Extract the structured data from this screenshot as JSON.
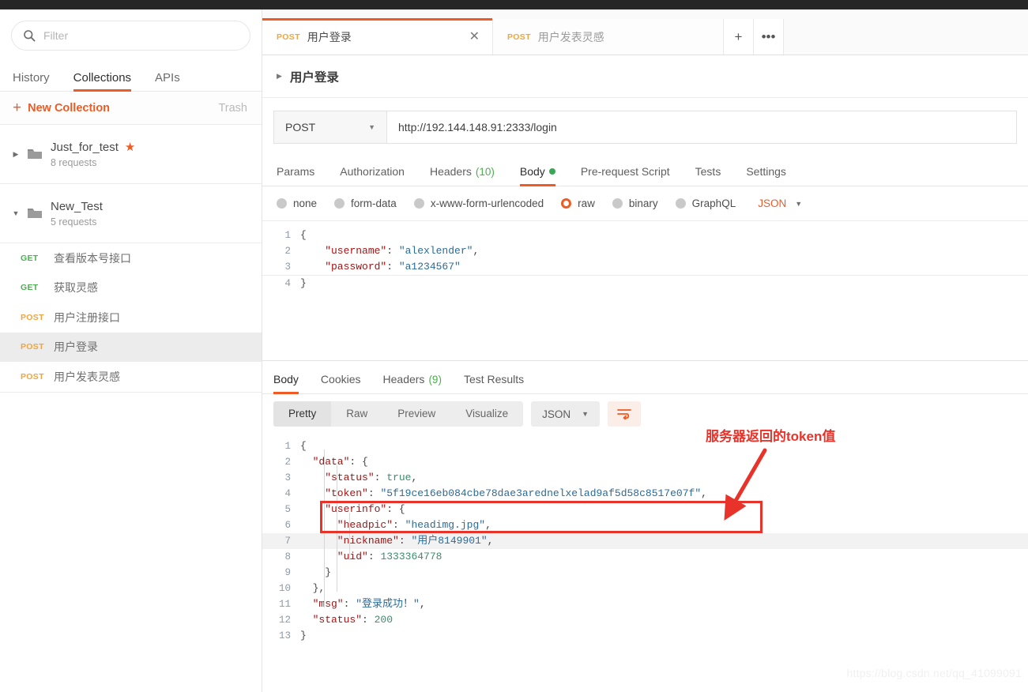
{
  "sidebar": {
    "search": {
      "placeholder": "Filter",
      "value": "",
      "icon": "search-icon"
    },
    "tabs": [
      {
        "label": "History",
        "active": false
      },
      {
        "label": "Collections",
        "active": true
      },
      {
        "label": "APIs",
        "active": false
      }
    ],
    "new_collection_label": "New Collection",
    "trash_label": "Trash",
    "collections": [
      {
        "name": "Just_for_test",
        "sub": "8 requests",
        "expanded": false,
        "starred": true
      },
      {
        "name": "New_Test",
        "sub": "5 requests",
        "expanded": true,
        "starred": false
      }
    ],
    "requests": [
      {
        "method": "GET",
        "name": "查看版本号接口",
        "selected": false
      },
      {
        "method": "GET",
        "name": "获取灵感",
        "selected": false
      },
      {
        "method": "POST",
        "name": "用户注册接口",
        "selected": false
      },
      {
        "method": "POST",
        "name": "用户登录",
        "selected": true
      },
      {
        "method": "POST",
        "name": "用户发表灵感",
        "selected": false
      }
    ]
  },
  "tabstrip": {
    "tabs": [
      {
        "method": "POST",
        "title": "用户登录",
        "active": true,
        "close": "✕"
      },
      {
        "method": "POST",
        "title": "用户发表灵感",
        "active": false,
        "close": ""
      }
    ],
    "new_tab_icon": "+",
    "more_icon": "•••"
  },
  "request": {
    "name": "用户登录",
    "method": "POST",
    "url": "http://192.144.148.91:2333/login",
    "tabs": [
      {
        "label": "Params",
        "active": false,
        "count": "",
        "dot": false
      },
      {
        "label": "Authorization",
        "active": false,
        "count": "",
        "dot": false
      },
      {
        "label": "Headers",
        "active": false,
        "count": "(10)",
        "dot": false
      },
      {
        "label": "Body",
        "active": true,
        "count": "",
        "dot": true
      },
      {
        "label": "Pre-request Script",
        "active": false,
        "count": "",
        "dot": false
      },
      {
        "label": "Tests",
        "active": false,
        "count": "",
        "dot": false
      },
      {
        "label": "Settings",
        "active": false,
        "count": "",
        "dot": false
      }
    ],
    "body_types": [
      {
        "label": "none",
        "selected": false
      },
      {
        "label": "form-data",
        "selected": false
      },
      {
        "label": "x-www-form-urlencoded",
        "selected": false
      },
      {
        "label": "raw",
        "selected": true
      },
      {
        "label": "binary",
        "selected": false
      },
      {
        "label": "GraphQL",
        "selected": false
      }
    ],
    "format": "JSON",
    "body_lines": [
      {
        "n": "1",
        "text": "{"
      },
      {
        "n": "2",
        "text": "    \"username\": \"alexlender\","
      },
      {
        "n": "3",
        "text": "    \"password\": \"a1234567\""
      },
      {
        "n": "4",
        "text": "}"
      }
    ]
  },
  "response": {
    "tabs": [
      {
        "label": "Body",
        "active": true,
        "count": ""
      },
      {
        "label": "Cookies",
        "active": false,
        "count": ""
      },
      {
        "label": "Headers",
        "active": false,
        "count": "(9)"
      },
      {
        "label": "Test Results",
        "active": false,
        "count": ""
      }
    ],
    "views": [
      {
        "label": "Pretty",
        "active": true
      },
      {
        "label": "Raw",
        "active": false
      },
      {
        "label": "Preview",
        "active": false
      },
      {
        "label": "Visualize",
        "active": false
      }
    ],
    "format": "JSON",
    "wrap_icon": "word-wrap-icon",
    "body_lines": [
      {
        "n": "1",
        "text": "{"
      },
      {
        "n": "2",
        "text": "  \"data\": {"
      },
      {
        "n": "3",
        "text": "    \"status\": true,"
      },
      {
        "n": "4",
        "text": "    \"token\": \"5f19ce16eb084cbe78dae3arednelxelad9af5d58c8517e07f\","
      },
      {
        "n": "5",
        "text": "    \"userinfo\": {"
      },
      {
        "n": "6",
        "text": "      \"headpic\": \"headimg.jpg\","
      },
      {
        "n": "7",
        "text": "      \"nickname\": \"用户8149901\","
      },
      {
        "n": "8",
        "text": "      \"uid\": 1333364778"
      },
      {
        "n": "9",
        "text": "    }"
      },
      {
        "n": "10",
        "text": "  },"
      },
      {
        "n": "11",
        "text": "  \"msg\": \"登录成功！\","
      },
      {
        "n": "12",
        "text": "  \"status\": 200"
      },
      {
        "n": "13",
        "text": "}"
      }
    ],
    "token_value": "5f19ce16eb084cbe78dae3arednelxelad9af5d58c8517e07f",
    "msg_value": "登录成功！",
    "status_value": "200",
    "uid_value": "1333364778",
    "nickname_value": "用户8149901",
    "headpic_value": "headimg.jpg"
  },
  "annotation": {
    "text": "服务器返回的token值",
    "color": "#e8332a"
  },
  "watermark": "https://blog.csdn.net/qq_41099091",
  "colors": {
    "accent": "#ef5b25",
    "get": "#4caf50",
    "post": "#f0a53e",
    "annotation": "#e8332a"
  }
}
